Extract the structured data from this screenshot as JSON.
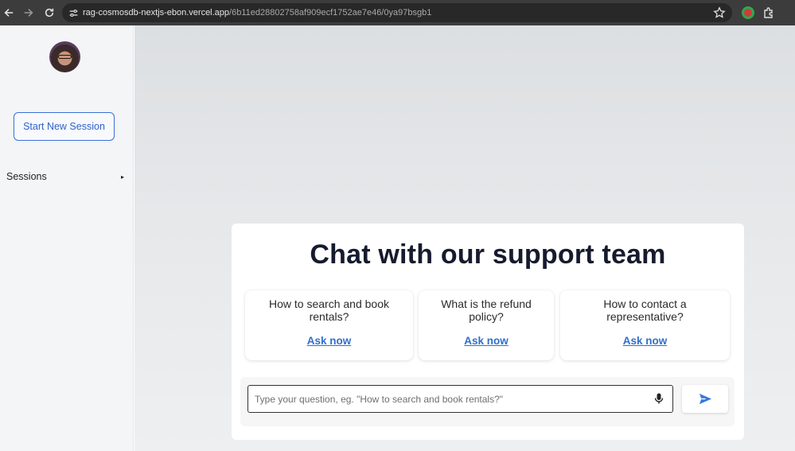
{
  "browser": {
    "url_host": "rag-cosmosdb-nextjs-ebon.vercel.app",
    "url_path": "/6b11ed28802758af909ecf1752ae7e46/0ya97bsgb1",
    "icons": [
      "back-arrow-icon",
      "forward-arrow-icon",
      "reload-icon",
      "site-info-icon",
      "bookmark-star-icon",
      "extension-icon",
      "puzzle-icon"
    ]
  },
  "sidebar": {
    "start_button_label": "Start New Session",
    "sessions_label": "Sessions",
    "sessions_caret": "▸"
  },
  "main": {
    "title": "Chat with our support team",
    "cards": [
      {
        "question": "How to search and book rentals?",
        "action": "Ask now"
      },
      {
        "question": "What is the refund policy?",
        "action": "Ask now"
      },
      {
        "question": "How to contact a representative?",
        "action": "Ask now"
      }
    ],
    "input": {
      "placeholder": "Type your question, eg. \"How to search and book rentals?\"",
      "value": ""
    }
  },
  "colors": {
    "accent": "#2f6fd0",
    "title": "#161b2e",
    "chrome": "#3c3c3c"
  }
}
